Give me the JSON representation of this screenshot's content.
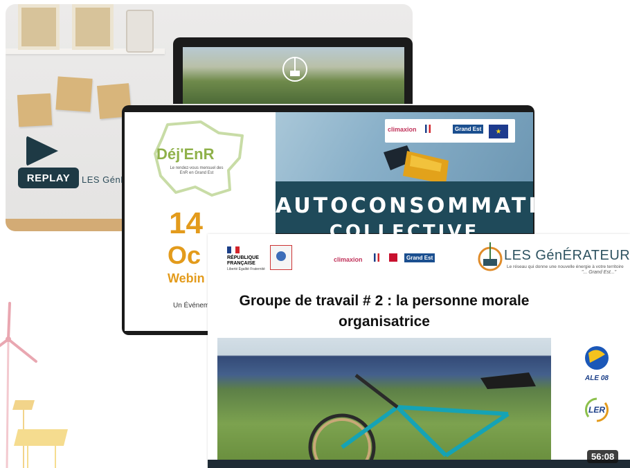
{
  "card_replay": {
    "replay_label": "REPLAY",
    "brand": "LES GénÉ"
  },
  "card_autoconso": {
    "logo_title": "Déj'EnR",
    "logo_tagline": "Le rendez-vous mensuel des EnR en Grand Est",
    "date_day": "14",
    "date_month": "Oc",
    "webinar": "Webin",
    "event_text": "Un Événem",
    "headline_line1": "AUTOCONSOMMATION",
    "headline_line2": "COLLECTIVE",
    "partners": {
      "climaxion": "climaxion",
      "grand_est": "Grand Est"
    }
  },
  "card_groupe": {
    "republique": "RÉPUBLIQUE FRANÇAISE",
    "republique_motto": "Liberté Égalité Fraternité",
    "climaxion": "climaxion",
    "grand_est": "Grand Est",
    "brand": "LES GénÉRATEURS",
    "brand_tagline": "Le réseau qui donne une nouvelle énergie à votre territoire",
    "brand_region": "\"... Grand Est...\"",
    "title_line1": "Groupe de travail # 2 : la personne morale",
    "title_line2": "organisatrice",
    "partner_ale": "ALE 08",
    "partner_ler": "LER",
    "duration": "56:08"
  },
  "colors": {
    "replay_navy": "#1e3a45",
    "dejenr_green": "#8fb14a",
    "date_orange": "#e39b1c",
    "autoconso_teal": "#1f4a5a"
  }
}
